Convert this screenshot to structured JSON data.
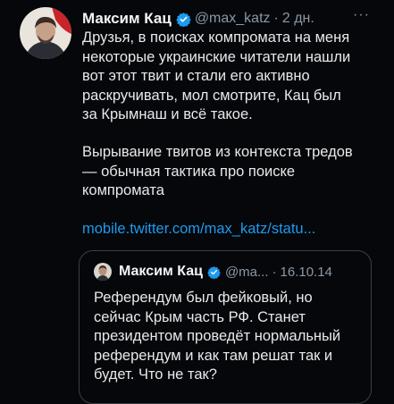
{
  "tweet": {
    "author_name": "Максим Кац",
    "handle": "@max_katz",
    "separator": "·",
    "time": "2 дн.",
    "more_icon": "more-icon",
    "paragraph1": "Друзья, в поисках компромата на меня\nнекоторые украинские читатели нашли\nвот этот твит и стали его активно\nраскручивать, мол смотрите, Кац был\nза Крымнаш и всё такое.",
    "paragraph2": "Вырывание твитов из контекста тредов\n— обычная тактика про поиске\nкомпромата",
    "link": "mobile.twitter.com/max_katz/statu..."
  },
  "quoted": {
    "author_name": "Максим Кац",
    "handle": "@ma...",
    "separator": "·",
    "date": "16.10.14",
    "text": "Референдум был фейковый, но\nсейчас Крым часть РФ. Станет\nпрезидентом проведёт нормальный\nреферендум и как там решат так и\nбудет. Что не так?"
  },
  "colors": {
    "background": "#05070a",
    "link": "#1d9bf0",
    "verified": "#1d9bf0",
    "secondary_text": "#8b98a5"
  }
}
